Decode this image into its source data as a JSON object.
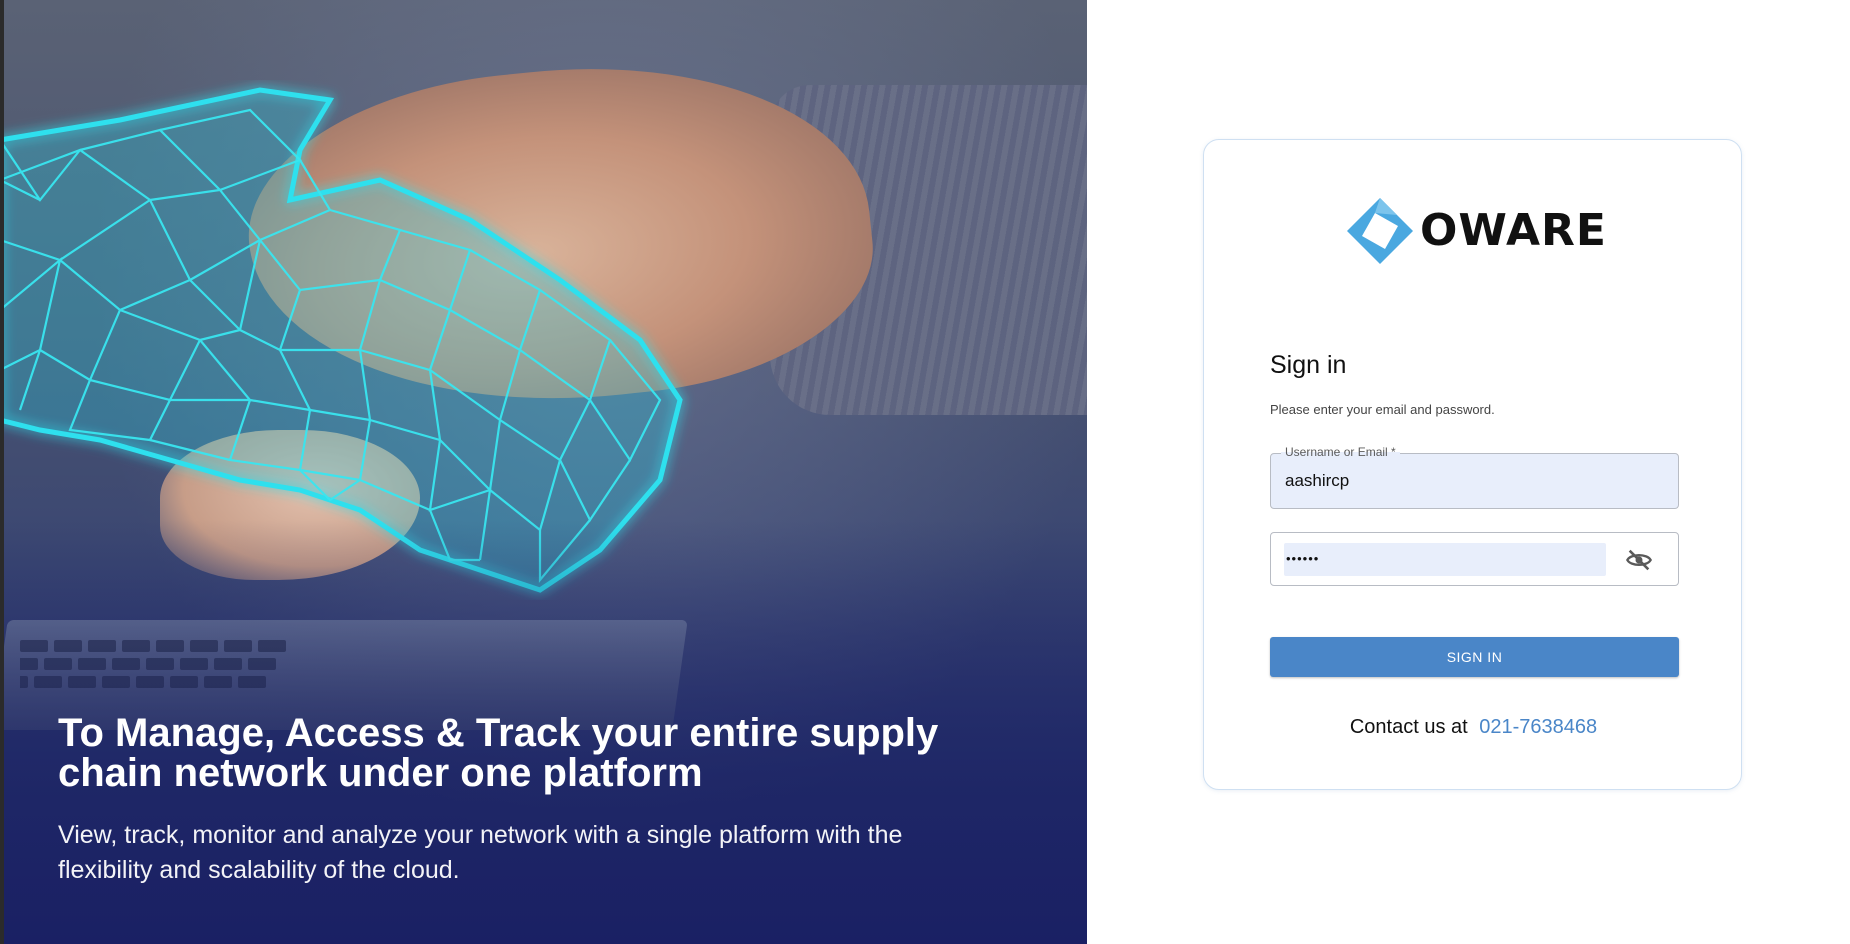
{
  "hero": {
    "title": "To Manage, Access & Track your entire supply chain network under one platform",
    "subtitle": "View, track, monitor and analyze your network with a single platform with the flexibility and scalability of the cloud."
  },
  "brand": {
    "logo_text": "OWARE",
    "logo_color": "#4aa8e0"
  },
  "login": {
    "title": "Sign in",
    "subtitle": "Please enter your email and password.",
    "username_label": "Username or Email *",
    "username_value": "aashircp",
    "password_dots": "••••••",
    "submit_label": "SIGN IN",
    "contact_prefix": "Contact us at",
    "contact_phone": "021-7638468"
  },
  "colors": {
    "accent": "#4a86c8",
    "field_fill": "#e8eefb",
    "card_border": "#cfe0f2",
    "mesh": "#2fe0ee"
  },
  "icons": {
    "password_toggle": "eye-off-icon"
  }
}
